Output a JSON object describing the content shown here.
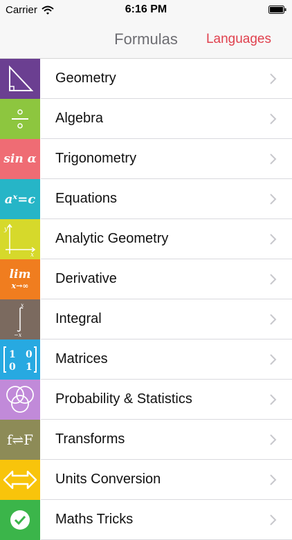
{
  "status_bar": {
    "carrier": "Carrier",
    "time": "6:16 PM"
  },
  "nav": {
    "title": "Formulas",
    "right_button": "Languages"
  },
  "items": [
    {
      "label": "Geometry",
      "color": "#6b3f91",
      "icon": "triangle-icon"
    },
    {
      "label": "Algebra",
      "color": "#8dc63f",
      "icon": "division-icon"
    },
    {
      "label": "Trigonometry",
      "color": "#ef6c74",
      "icon": "sine-icon",
      "icon_text": "sin α"
    },
    {
      "label": "Equations",
      "color": "#26b5c7",
      "icon": "exponent-equation-icon",
      "icon_text": "aˣ=c"
    },
    {
      "label": "Analytic Geometry",
      "color": "#d6d92b",
      "icon": "axes-icon"
    },
    {
      "label": "Derivative",
      "color": "#f07d1f",
      "icon": "limit-icon",
      "icon_text": "lim",
      "icon_subtext": "x→∞"
    },
    {
      "label": "Integral",
      "color": "#7b6a5f",
      "icon": "integral-icon"
    },
    {
      "label": "Matrices",
      "color": "#27a9e1",
      "icon": "matrix-icon"
    },
    {
      "label": "Probability & Statistics",
      "color": "#c18ad9",
      "icon": "venn-diagram-icon"
    },
    {
      "label": "Transforms",
      "color": "#8d8b57",
      "icon": "transform-icon",
      "icon_text": "f⇌F"
    },
    {
      "label": "Units Conversion",
      "color": "#f8c40b",
      "icon": "double-arrow-icon"
    },
    {
      "label": "Maths Tricks",
      "color": "#3bb54a",
      "icon": "checkmark-icon"
    }
  ]
}
